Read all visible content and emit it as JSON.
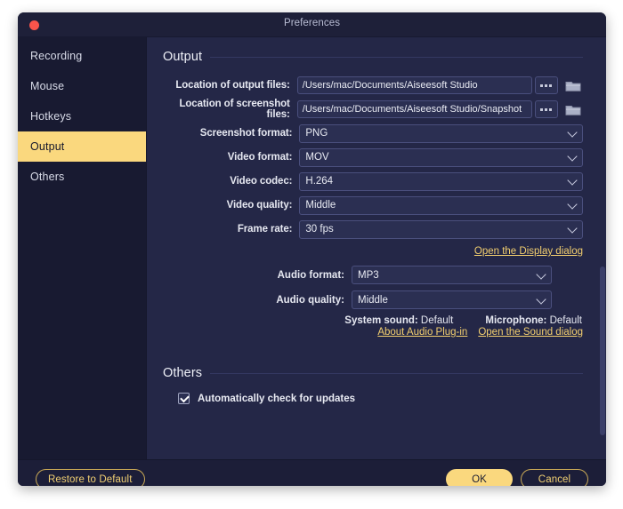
{
  "window": {
    "title": "Preferences",
    "close_icon": "close-dot-icon"
  },
  "sidebar": {
    "items": [
      {
        "label": "Recording",
        "active": false
      },
      {
        "label": "Mouse",
        "active": false
      },
      {
        "label": "Hotkeys",
        "active": false
      },
      {
        "label": "Output",
        "active": true
      },
      {
        "label": "Others",
        "active": false
      }
    ]
  },
  "sections": {
    "output": {
      "title": "Output"
    },
    "others": {
      "title": "Others"
    }
  },
  "fields": {
    "output_location": {
      "label": "Location of output files:",
      "value": "/Users/mac/Documents/Aiseesoft Studio",
      "browse_icon": "ellipsis-icon",
      "folder_icon": "folder-icon"
    },
    "screenshot_location": {
      "label": "Location of screenshot files:",
      "value": "/Users/mac/Documents/Aiseesoft Studio/Snapshot",
      "browse_icon": "ellipsis-icon",
      "folder_icon": "folder-icon"
    },
    "screenshot_format": {
      "label": "Screenshot format:",
      "value": "PNG"
    },
    "video_format": {
      "label": "Video format:",
      "value": "MOV"
    },
    "video_codec": {
      "label": "Video codec:",
      "value": "H.264"
    },
    "video_quality": {
      "label": "Video quality:",
      "value": "Middle"
    },
    "frame_rate": {
      "label": "Frame rate:",
      "value": "30 fps"
    },
    "audio_format": {
      "label": "Audio format:",
      "value": "MP3"
    },
    "audio_quality": {
      "label": "Audio quality:",
      "value": "Middle"
    }
  },
  "devices": {
    "system_sound_label": "System sound:",
    "system_sound_value": "Default",
    "microphone_label": "Microphone:",
    "microphone_value": "Default"
  },
  "links": {
    "display_dialog": "Open the Display dialog",
    "about_audio_plugin": "About Audio Plug-in",
    "sound_dialog": "Open the Sound dialog"
  },
  "checkbox": {
    "auto_update_label": "Automatically check for updates",
    "auto_update_checked": true,
    "check_icon": "check-icon"
  },
  "footer": {
    "restore_label": "Restore to Default",
    "ok_label": "OK",
    "cancel_label": "Cancel"
  },
  "colors": {
    "accent": "#fad87e",
    "link": "#f3cf6f",
    "window_bg": "#1d1f36",
    "content_bg": "#242747",
    "sidebar_bg": "#181a31",
    "close_red": "#f9544b"
  }
}
